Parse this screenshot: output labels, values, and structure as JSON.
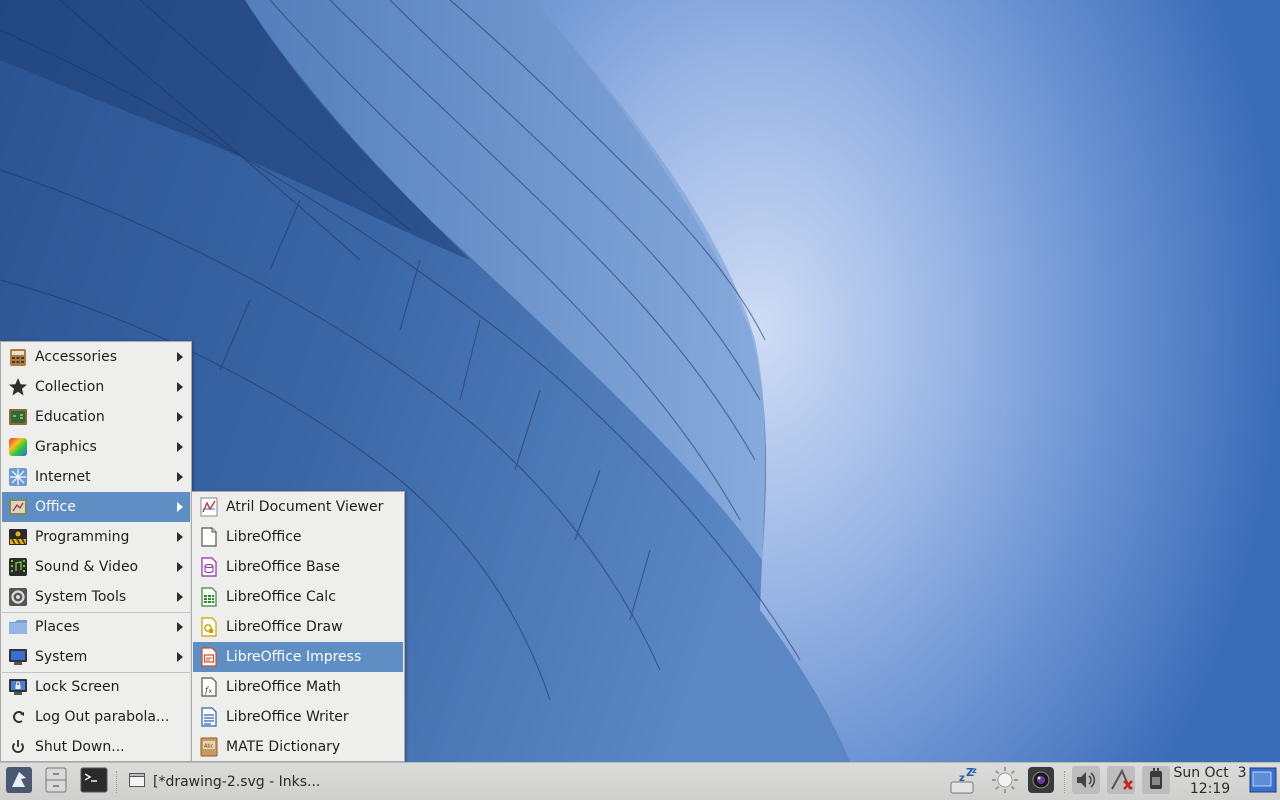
{
  "main_menu": {
    "items": [
      {
        "label": "Accessories",
        "icon": "accessories-icon",
        "submenu": true
      },
      {
        "label": "Collection",
        "icon": "star-icon",
        "submenu": true
      },
      {
        "label": "Education",
        "icon": "education-icon",
        "submenu": true
      },
      {
        "label": "Graphics",
        "icon": "graphics-icon",
        "submenu": true
      },
      {
        "label": "Internet",
        "icon": "internet-icon",
        "submenu": true
      },
      {
        "label": "Office",
        "icon": "office-icon",
        "submenu": true,
        "active": true
      },
      {
        "label": "Programming",
        "icon": "programming-icon",
        "submenu": true
      },
      {
        "label": "Sound & Video",
        "icon": "sound-video-icon",
        "submenu": true
      },
      {
        "label": "System Tools",
        "icon": "system-tools-icon",
        "submenu": true
      }
    ],
    "places_label": "Places",
    "system_label": "System",
    "lock_label": "Lock Screen",
    "logout_label": "Log Out parabola...",
    "shutdown_label": "Shut Down..."
  },
  "office_submenu": {
    "items": [
      {
        "label": "Atril Document Viewer",
        "icon": "atril-icon"
      },
      {
        "label": "LibreOffice",
        "icon": "libreoffice-icon"
      },
      {
        "label": "LibreOffice Base",
        "icon": "libreoffice-base-icon"
      },
      {
        "label": "LibreOffice Calc",
        "icon": "libreoffice-calc-icon"
      },
      {
        "label": "LibreOffice Draw",
        "icon": "libreoffice-draw-icon"
      },
      {
        "label": "LibreOffice Impress",
        "icon": "libreoffice-impress-icon",
        "highlighted": true
      },
      {
        "label": "LibreOffice Math",
        "icon": "libreoffice-math-icon"
      },
      {
        "label": "LibreOffice Writer",
        "icon": "libreoffice-writer-icon"
      },
      {
        "label": "MATE Dictionary",
        "icon": "dictionary-icon"
      }
    ]
  },
  "panel": {
    "task_label": "[*drawing-2.svg - Inks...",
    "clock_date": "Sun Oct  3",
    "clock_time": "12:19"
  },
  "colors": {
    "highlight": "#5f8ec4",
    "menu_bg": "#eeeeec",
    "panel_bg": "#d6d6d4"
  }
}
